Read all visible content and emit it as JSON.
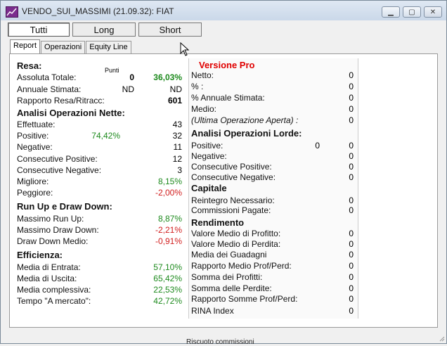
{
  "window": {
    "title": "VENDO_SUI_MASSIMI (21.09.32): FIAT"
  },
  "filters": [
    "Tutti",
    "Long",
    "Short"
  ],
  "tabs": [
    "Report",
    "Operazioni",
    "Equity Line"
  ],
  "left": {
    "resa": {
      "heading": "Resa:",
      "punti_label": "Punti",
      "assoluta_label": "Assoluta Totale:",
      "assoluta_punti": "0",
      "assoluta_pct": "36,03%",
      "annuale_label": "Annuale Stimata:",
      "annuale_punti": "ND",
      "annuale_pct": "ND",
      "rapporto_label": "Rapporto Resa/Ritracc:",
      "rapporto_val": "601"
    },
    "nette": {
      "heading": "Analisi Operazioni Nette:",
      "effettuate_label": "Effettuate:",
      "effettuate_val": "43",
      "positive_label": "Positive:",
      "positive_pct": "74,42%",
      "positive_val": "32",
      "negative_label": "Negative:",
      "negative_val": "11",
      "cons_pos_label": "Consecutive Positive:",
      "cons_pos_val": "12",
      "cons_neg_label": "Consecutive Negative:",
      "cons_neg_val": "3",
      "migliore_label": "Migliore:",
      "migliore_val": "8,15%",
      "peggiore_label": "Peggiore:",
      "peggiore_val": "-2,00%"
    },
    "runup": {
      "heading": "Run Up e Draw Down:",
      "max_runup_label": "Massimo Run Up:",
      "max_runup_val": "8,87%",
      "max_dd_label": "Massimo Draw Down:",
      "max_dd_val": "-2,21%",
      "dd_medio_label": "Draw Down Medio:",
      "dd_medio_val": "-0,91%"
    },
    "efficienza": {
      "heading": "Efficienza:",
      "entrata_label": "Media di Entrata:",
      "entrata_val": "57,10%",
      "uscita_label": "Media di Uscita:",
      "uscita_val": "65,42%",
      "complessiva_label": "Media complessiva:",
      "complessiva_val": "22,53%",
      "tempo_label": "Tempo \"A mercato\":",
      "tempo_val": "42,72%"
    }
  },
  "right": {
    "pro_heading": "Versione Pro",
    "netto_label": "Netto:",
    "netto_val": "0",
    "pct_label": "% :",
    "pct_val": "0",
    "pct_annuale_label": "% Annuale Stimata:",
    "pct_annuale_val": "0",
    "medio_label": "Medio:",
    "medio_val": "0",
    "ultima_label": "(Ultima Operazione Aperta) :",
    "ultima_val": "0",
    "lorde": {
      "heading": "Analisi Operazioni Lorde:",
      "positive_label": "Positive:",
      "positive_a": "0",
      "positive_b": "0",
      "negative_label": "Negative:",
      "negative_val": "0",
      "cons_pos_label": "Consecutive Positive:",
      "cons_pos_val": "0",
      "cons_neg_label": "Consecutive Negative:",
      "cons_neg_val": "0"
    },
    "capitale": {
      "heading": "Capitale",
      "reintegro_label": "Reintegro Necessario:",
      "reintegro_val": "0",
      "commissioni_label": "Commissioni Pagate:",
      "commissioni_val": "0"
    },
    "rendimento": {
      "heading": "Rendimento",
      "vm_profitto_label": "Valore Medio di Profitto:",
      "vm_profitto_val": "0",
      "vm_perdita_label": "Valore Medio di Perdita:",
      "vm_perdita_val": "0",
      "media_guadagni_label": "Media dei Guadagni",
      "media_guadagni_val": "0",
      "rapp_medio_label": "Rapporto Medio Prof/Perd:",
      "rapp_medio_val": "0",
      "somma_profitti_label": "Somma dei Profitti:",
      "somma_profitti_val": "0",
      "somma_perdite_label": "Somma delle Perdite:",
      "somma_perdite_val": "0",
      "rapp_somme_label": "Rapporto Somme Prof/Perd:",
      "rapp_somme_val": "0",
      "rina_label": "RINA Index",
      "rina_val": "0"
    }
  },
  "footer": "Riscuoto commissioni"
}
